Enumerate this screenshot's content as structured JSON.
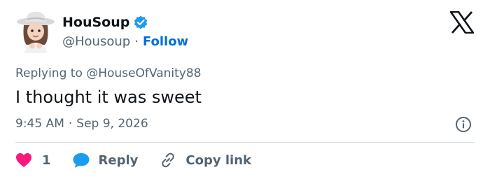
{
  "author": {
    "display_name": "HouSoup",
    "handle": "@Housoup",
    "verified": true,
    "follow_label": "Follow",
    "separator": "·"
  },
  "tweet": {
    "replying_prefix": "Replying to",
    "replying_to": "@HouseOfVanity88",
    "text": "I thought it was sweet",
    "time": "9:45 AM",
    "separator": "·",
    "date": "Sep 9, 2026"
  },
  "actions": {
    "like_count": "1",
    "reply_label": "Reply",
    "copy_link_label": "Copy link"
  },
  "colors": {
    "accent": "#1d9bf0",
    "like": "#f91880",
    "muted": "#536471",
    "text": "#0f1419",
    "divider": "#cfd9de"
  },
  "icons": {
    "avatar": "cowgirl-memoji-avatar",
    "verified": "verified-badge-icon",
    "logo": "x-logo-icon",
    "info": "info-icon",
    "like": "heart-icon",
    "reply": "speech-bubble-icon",
    "copy": "link-icon"
  }
}
